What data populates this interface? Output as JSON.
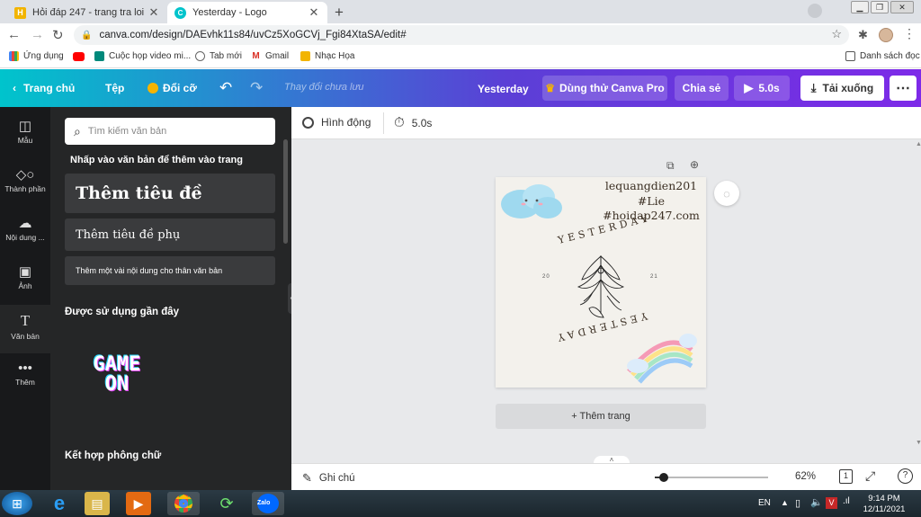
{
  "browser": {
    "tabs": [
      {
        "title": "Hỏi đáp 247 - trang tra loi",
        "icon": "hoidap-favicon-icon",
        "active": false
      },
      {
        "title": "Yesterday - Logo",
        "icon": "canva-favicon-icon",
        "active": true
      }
    ],
    "url": "canva.com/design/DAEvhk11s84/uvCz5XoGCVj_Fgi84XtaSA/edit#",
    "bookmarks": [
      "Ứng dụng",
      "Cuộc họp video mi...",
      "Tab mới",
      "Gmail",
      "Nhạc Họa"
    ],
    "reading_list": "Danh sách đọc"
  },
  "editor": {
    "home": "Trang chủ",
    "file": "Tệp",
    "resize": "Đổi cỡ",
    "save_status": "Thay đổi chưa lưu",
    "design_title": "Yesterday",
    "try_pro": "Dùng thử Canva Pro",
    "share": "Chia sẻ",
    "play": "5.0s",
    "download": "Tải xuống"
  },
  "rail": [
    {
      "label": "Mẫu",
      "icon": "template-icon"
    },
    {
      "label": "Thành phần",
      "icon": "elements-icon"
    },
    {
      "label": "Nội dung ...",
      "icon": "upload-icon"
    },
    {
      "label": "Ảnh",
      "icon": "photo-icon"
    },
    {
      "label": "Văn bản",
      "icon": "text-icon"
    },
    {
      "label": "Thêm",
      "icon": "more-icon"
    }
  ],
  "panel": {
    "search_placeholder": "Tìm kiếm văn bản",
    "hint": "Nhấp vào văn bản để thêm vào trang",
    "heading": "Thêm tiêu đề",
    "subheading": "Thêm tiêu đề phụ",
    "body": "Thêm một vài nội dung cho thân văn bản",
    "recent_title": "Được sử dụng gần đây",
    "recent_sample_line1": "GAME",
    "recent_sample_line2": "ON",
    "combos_title": "Kết hợp phông chữ"
  },
  "canvas_toolbar": {
    "animate": "Hình động",
    "duration": "5.0s"
  },
  "design": {
    "text_line1": "lequangdien201",
    "text_line2": "#Lie",
    "text_line3": "#hoidap247.com",
    "arc_top": "YESTERDAY",
    "arc_bottom": "YESTERDAY",
    "left_num": "20",
    "right_num": "21"
  },
  "add_page": "+ Thêm trang",
  "bottom": {
    "notes": "Ghi chú",
    "zoom": "62%",
    "page_count": "1",
    "zoom_level": 0.62
  },
  "taskbar": {
    "lang": "EN",
    "time": "9:14 PM",
    "date": "12/11/2021"
  },
  "colors": {
    "accent": "#7d2ae8",
    "teal": "#00c4cc",
    "pro_crown": "#f5b400"
  }
}
